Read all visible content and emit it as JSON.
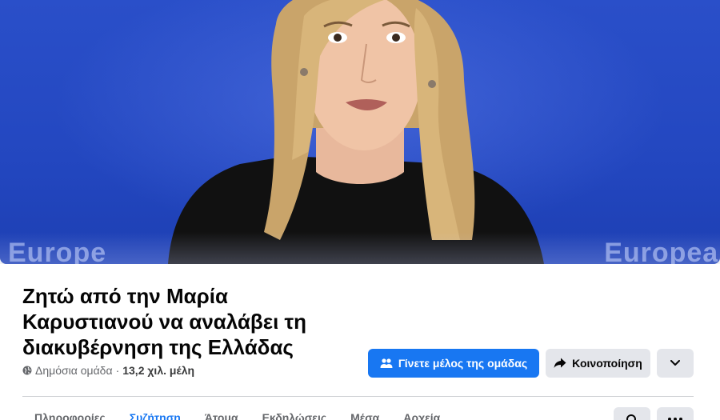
{
  "cover": {
    "watermark_left": "Europe",
    "watermark_right": "European"
  },
  "group": {
    "title_lines": [
      "Ζητώ από την Μαρία",
      "Καρυστιανού να αναλάβει τη",
      "διακυβέρνηση της Ελλάδας"
    ],
    "privacy": "Δημόσια ομάδα",
    "separator": "·",
    "members": "13,2 χιλ. μέλη"
  },
  "actions": {
    "join_label": "Γίνετε μέλος της ομάδας",
    "share_label": "Κοινοποίηση"
  },
  "tabs": [
    {
      "label": "Πληροφορίες",
      "active": false
    },
    {
      "label": "Συζήτηση",
      "active": true
    },
    {
      "label": "Άτομα",
      "active": false
    },
    {
      "label": "Εκδηλώσεις",
      "active": false
    },
    {
      "label": "Μέσα",
      "active": false
    },
    {
      "label": "Αρχεία",
      "active": false
    }
  ],
  "colors": {
    "accent": "#1877f2",
    "secondary_button": "#e4e6eb",
    "muted_text": "#65676b"
  }
}
